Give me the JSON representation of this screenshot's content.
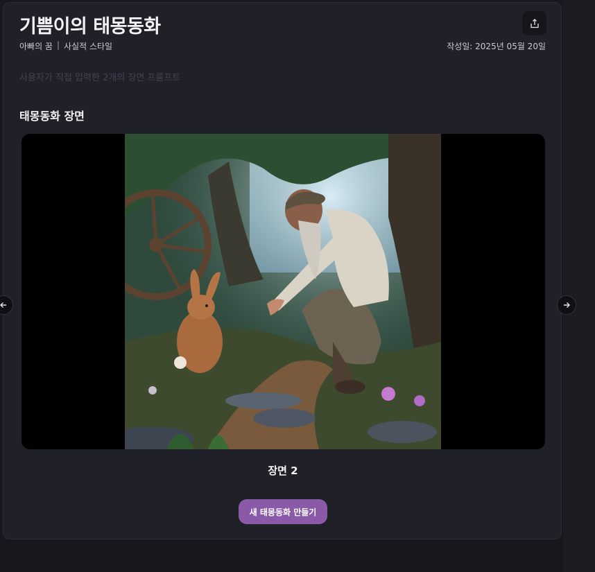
{
  "header": {
    "title": "기쁨이의 태몽동화",
    "dream_owner": "아빠의 꿈",
    "separator": "|",
    "style": "사실적 스타일",
    "date": "작성일: 2025년 05월 20일",
    "share_icon": "share-icon"
  },
  "prompt_note": "사용자가 직접 입력한 2개의 장면 프롬프트",
  "section_title": "태몽동화 장면",
  "scene": {
    "label": "장면 2",
    "image_alt": "forest scene: bearded man in flat cap crouching toward a rabbit"
  },
  "nav": {
    "prev_icon": "arrow-left-icon",
    "next_icon": "arrow-right-icon"
  },
  "actions": {
    "new_story_label": "새 태몽동화 만들기"
  },
  "colors": {
    "background": "#17181d",
    "card": "#202128",
    "accent_button": "#8a5aa8"
  }
}
